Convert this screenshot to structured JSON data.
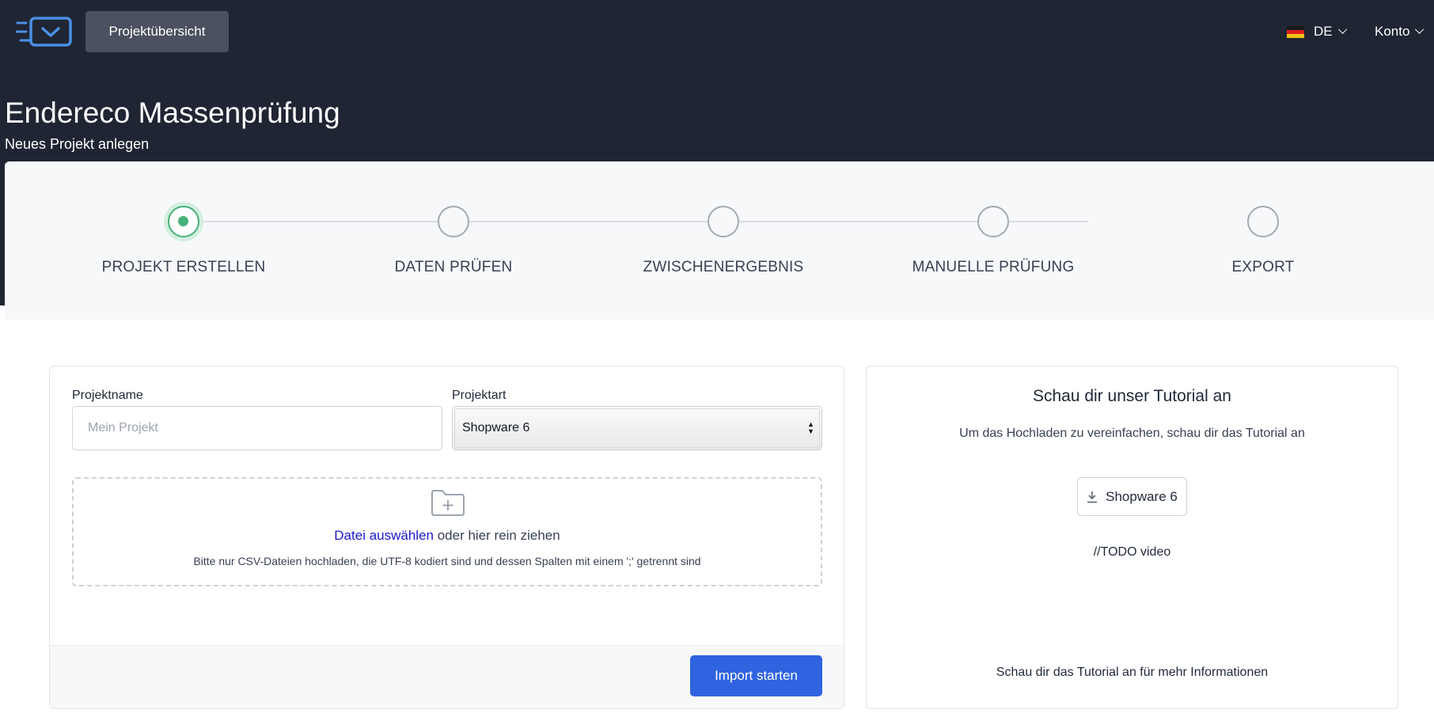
{
  "header": {
    "nav_button": "Projektübersicht",
    "language": {
      "code": "DE",
      "flag": "germany-flag-icon"
    },
    "account": "Konto",
    "colors": {
      "background": "#1f2533",
      "nav_button": "#4b5160"
    }
  },
  "page": {
    "title": "Endereco Massenprüfung",
    "subtitle": "Neues Projekt anlegen"
  },
  "stepper": {
    "active_index": 0,
    "active_color": "#46b17b",
    "steps": [
      {
        "label": "PROJEKT ERSTELLEN"
      },
      {
        "label": "DATEN PRÜFEN"
      },
      {
        "label": "ZWISCHENERGEBNIS"
      },
      {
        "label": "MANUELLE PRÜFUNG"
      },
      {
        "label": "EXPORT"
      }
    ]
  },
  "form": {
    "project_name": {
      "label": "Projektname",
      "value": "",
      "placeholder": "Mein Projekt"
    },
    "project_type": {
      "label": "Projektart",
      "selected": "Shopware 6"
    },
    "upload": {
      "link_text": "Datei auswählen",
      "drag_text": "oder hier rein ziehen",
      "hint": "Bitte nur CSV-Dateien hochladen, die UTF-8 kodiert sind und dessen Spalten mit einem ';' getrennt sind",
      "icon": "folder-plus-icon"
    },
    "submit_label": "Import starten",
    "submit_color": "#2f63e0"
  },
  "tutorial": {
    "title": "Schau dir unser Tutorial an",
    "text": "Um das Hochladen zu vereinfachen, schau dir das Tutorial an",
    "download_button": {
      "label": "Shopware 6",
      "icon": "download-icon"
    },
    "video_placeholder": "//TODO video",
    "more_info": "Schau dir das Tutorial an für mehr Informationen"
  }
}
